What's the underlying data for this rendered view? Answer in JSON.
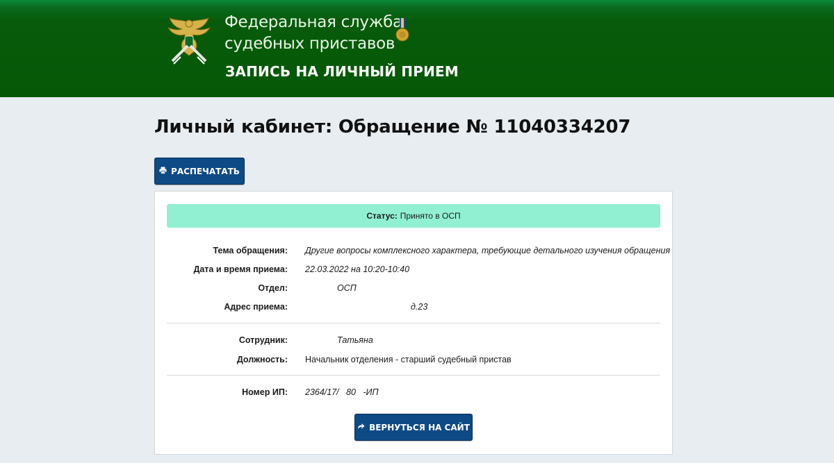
{
  "header": {
    "org_line1": "Федеральная служба",
    "org_line2": "судебных приставов",
    "subtitle": "ЗАПИСЬ НА ЛИЧНЫЙ ПРИЕМ",
    "logo_icon": "fssp-eagle-emblem-icon",
    "medal_icon": "medal-icon"
  },
  "page": {
    "title": "Личный кабинет: Обращение № 11040334207"
  },
  "toolbar": {
    "print_label": "РАСПЕЧАТАТЬ",
    "print_icon": "printer-icon"
  },
  "status": {
    "label": "Статус:",
    "value": "Принято в ОСП"
  },
  "details": [
    {
      "label": "Тема обращения:",
      "value": "Другие вопросы комплексного характера, требующие детального изучения обращения"
    },
    {
      "label": "Дата и время приема:",
      "value": "22.03.2022 на 10:20-10:40"
    },
    {
      "label": "Отдел:",
      "value": "ОСП"
    },
    {
      "label": "Адрес приема:",
      "value": "д.23"
    }
  ],
  "employee": [
    {
      "label": "Сотрудник:",
      "value": "Татьяна"
    },
    {
      "label": "Должность:",
      "value": "Начальник отделения - старший судебный пристав"
    }
  ],
  "case": [
    {
      "label": "Номер ИП:",
      "value": "2364/17/   80   -ИП"
    }
  ],
  "footer": {
    "back_label": "ВЕРНУТЬСЯ НА САЙТ",
    "back_icon": "share-arrow-icon"
  },
  "colors": {
    "header_green": "#055806",
    "button_blue": "#0d4a86",
    "status_mint": "#91f0d2",
    "page_bg": "#e7edf0"
  }
}
